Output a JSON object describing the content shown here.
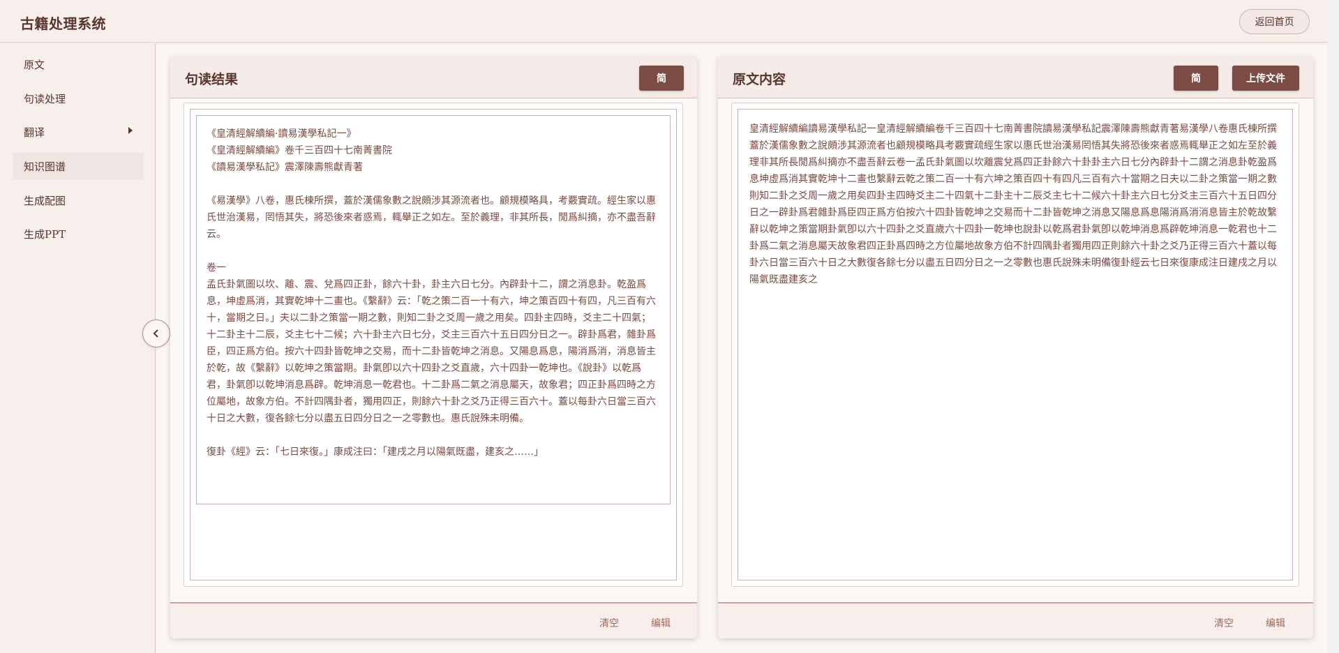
{
  "app": {
    "title": "古籍处理系统",
    "home_button": "返回首页"
  },
  "sidebar": {
    "items": [
      {
        "label": "原文"
      },
      {
        "label": "句读处理"
      },
      {
        "label": "翻译"
      },
      {
        "label": "知识图谱"
      },
      {
        "label": "生成配图"
      },
      {
        "label": "生成PPT"
      }
    ]
  },
  "left_panel": {
    "title": "句读结果",
    "simplify_button": "简",
    "content": "《皇清經解續編·讀易漢學私記一》\n《皇清經解續編》卷千三百四十七南菁書院\n《讀易漢學私記》震澤陳壽熊獻青著\n\n《易漢學》八卷，惠氏棟所撰，蓋於漢儒象數之說頗涉其源流者也。顧規模略具，考覈實疏。經生家以惠氏世治漢易，罔悟其失，將恐後來者惑焉，輒舉正之如左。至於義理，非其所長，閒爲糾摘，亦不盡吾辭云。\n\n卷一\n孟氏卦氣圖以坎、離、震、兌爲四正卦，餘六十卦，卦主六日七分。內辟卦十二，謂之消息卦。乾盈爲息，坤虛爲消，其實乾坤十二畫也。《繫辭》云：「乾之策二百一十有六，坤之策百四十有四，凡三百有六十，當期之日。」夫以二卦之策當一期之數，則知二卦之爻周一歲之用矣。四卦主四時，爻主二十四氣；十二卦主十二辰，爻主七十二候；六十卦主六日七分，爻主三百六十五日四分日之一。辟卦爲君，雜卦爲臣，四正爲方伯。按六十四卦皆乾坤之交易，而十二卦皆乾坤之消息。又陽息爲息，陽消爲消，消息皆主於乾，故《繫辭》以乾坤之策當期。卦氣卽以六十四卦之爻直歲，六十四卦一乾坤也。《說卦》以乾爲君，卦氣卽以乾坤消息爲辟。乾坤消息一乾君也。十二卦爲二氣之消息屬天，故象君；四正卦爲四時之方位屬地，故象方伯。不計四隅卦者，獨用四正，則餘六十卦之爻乃正得三百六十。蓋以每卦六日當三百六十日之大數，復各餘七分以盡五日四分日之一之零數也。惠氏說殊未明備。\n\n復卦《經》云：「七日來復。」康成注曰：「建戌之月以陽氣既盡，建亥之……」",
    "clear_link": "清空",
    "edit_link": "编辑"
  },
  "right_panel": {
    "title": "原文内容",
    "simplify_button": "简",
    "upload_button": "上传文件",
    "content": "皇清經解續編讀易漢學私記一皇清經解續編卷千三百四十七南菁書院讀易漢學私記震澤陳壽熊獻青著易漢學八卷惠氏棟所撰蓋於漢儒象數之說頗涉其源流者也顧規模略具考覈實疏經生家以惠氏世治漢易罔悟其失將恐後來者惑焉輒舉正之如左至於義理非其所長閒爲糾摘亦不盡吾辭云卷一孟氏卦氣圖以坎離震兌爲四正卦餘六十卦卦主六日七分內辟卦十二謂之消息卦乾盈爲息坤虛爲消其實乾坤十二畫也繫辭云乾之策二百一十有六坤之策百四十有四凡三百有六十當期之日夫以二卦之策當一期之數則知二卦之爻周一歲之用矣四卦主四時爻主二十四氣十二卦主十二辰爻主七十二候六十卦主六日七分爻主三百六十五日四分日之一辟卦爲君雜卦爲臣四正爲方伯按六十四卦皆乾坤之交易而十二卦皆乾坤之消息又陽息爲息陽消爲消消息皆主於乾故繫辭以乾坤之策當期卦氣卽以六十四卦之爻直歲六十四卦一乾坤也說卦以乾爲君卦氣卽以乾坤消息爲辟乾坤消息一乾君也十二卦爲二氣之消息屬天故象君四正卦爲四時之方位屬地故象方伯不計四隅卦者獨用四正則餘六十卦之爻乃正得三百六十蓋以每卦六日當三百六十日之大數復各餘七分以盡五日四分日之一之零數也惠氏說殊未明備復卦經云七日來復康成注日建戌之月以陽氣既盡建亥之",
    "clear_link": "清空",
    "edit_link": "编辑"
  }
}
